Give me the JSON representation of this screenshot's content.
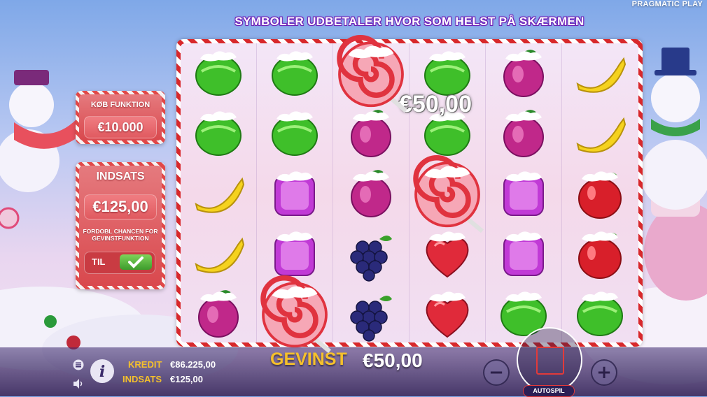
{
  "brand": "PRAGMATIC PLAY",
  "banner": "SYMBOLER UDBETALER HVOR SOM HELST PÅ SKÆRMEN",
  "win_popup": "€50,00",
  "buy_feature": {
    "title": "KØB FUNKTION",
    "price": "€10.000"
  },
  "bet_panel": {
    "title": "INDSATS",
    "amount": "€125,00",
    "description": "FORDOBL CHANCEN FOR GEVINSTFUNKTION",
    "toggle_label": "TIL"
  },
  "footer": {
    "credit_label": "KREDIT",
    "credit_value": "€86.225,00",
    "bet_label": "INDSATS",
    "bet_value": "€125,00",
    "win_label": "GEVINST",
    "win_value": "€50,00",
    "autospin_label": "AUTOSPIL",
    "minus_label": "−",
    "plus_label": "+"
  },
  "grid": {
    "columns": 6,
    "rows": 5,
    "symbols": [
      [
        "green-candy",
        "green-candy",
        "lollipop",
        "green-candy",
        "purple-plum",
        "banana"
      ],
      [
        "green-candy",
        "green-candy",
        "purple-plum",
        "green-candy",
        "purple-plum",
        "banana"
      ],
      [
        "banana",
        "purple-square",
        "purple-plum",
        "lollipop",
        "purple-square",
        "red-apple"
      ],
      [
        "banana",
        "purple-square",
        "grapes",
        "red-heart",
        "purple-square",
        "red-apple"
      ],
      [
        "purple-plum",
        "lollipop",
        "grapes",
        "red-heart",
        "green-candy",
        "green-candy"
      ]
    ]
  },
  "colors": {
    "accent_gold": "#f5c02c",
    "frame_red": "#d8282b",
    "panel_red": "#d9484d"
  }
}
